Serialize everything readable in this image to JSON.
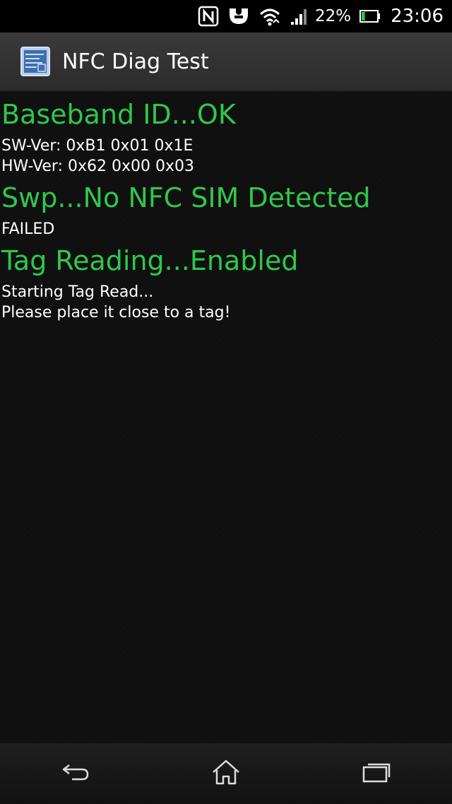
{
  "status_bar": {
    "icons": [
      "nfc-icon",
      "usb-debug-icon",
      "wifi-icon",
      "signal-icon"
    ],
    "battery_percent": "22%",
    "battery_level": 0.22,
    "time": "23:06"
  },
  "action_bar": {
    "app_icon": "app-icon",
    "title": "NFC Diag Test"
  },
  "sections": {
    "baseband": {
      "heading": "Baseband ID...OK",
      "lines": [
        "SW-Ver: 0xB1 0x01 0x1E",
        "HW-Ver: 0x62 0x00 0x03"
      ]
    },
    "swp": {
      "heading": "Swp...No NFC SIM Detected",
      "lines": [
        "FAILED"
      ]
    },
    "tag_reading": {
      "heading": "Tag Reading...Enabled",
      "lines": [
        "Starting Tag Read...",
        "Please place it close to a tag!"
      ]
    }
  },
  "nav_bar": {
    "buttons": [
      "back-icon",
      "home-icon",
      "recent-apps-icon"
    ]
  },
  "colors": {
    "heading_green": "#2ec84a",
    "background": "#0d0d0d",
    "text": "#ffffff"
  }
}
